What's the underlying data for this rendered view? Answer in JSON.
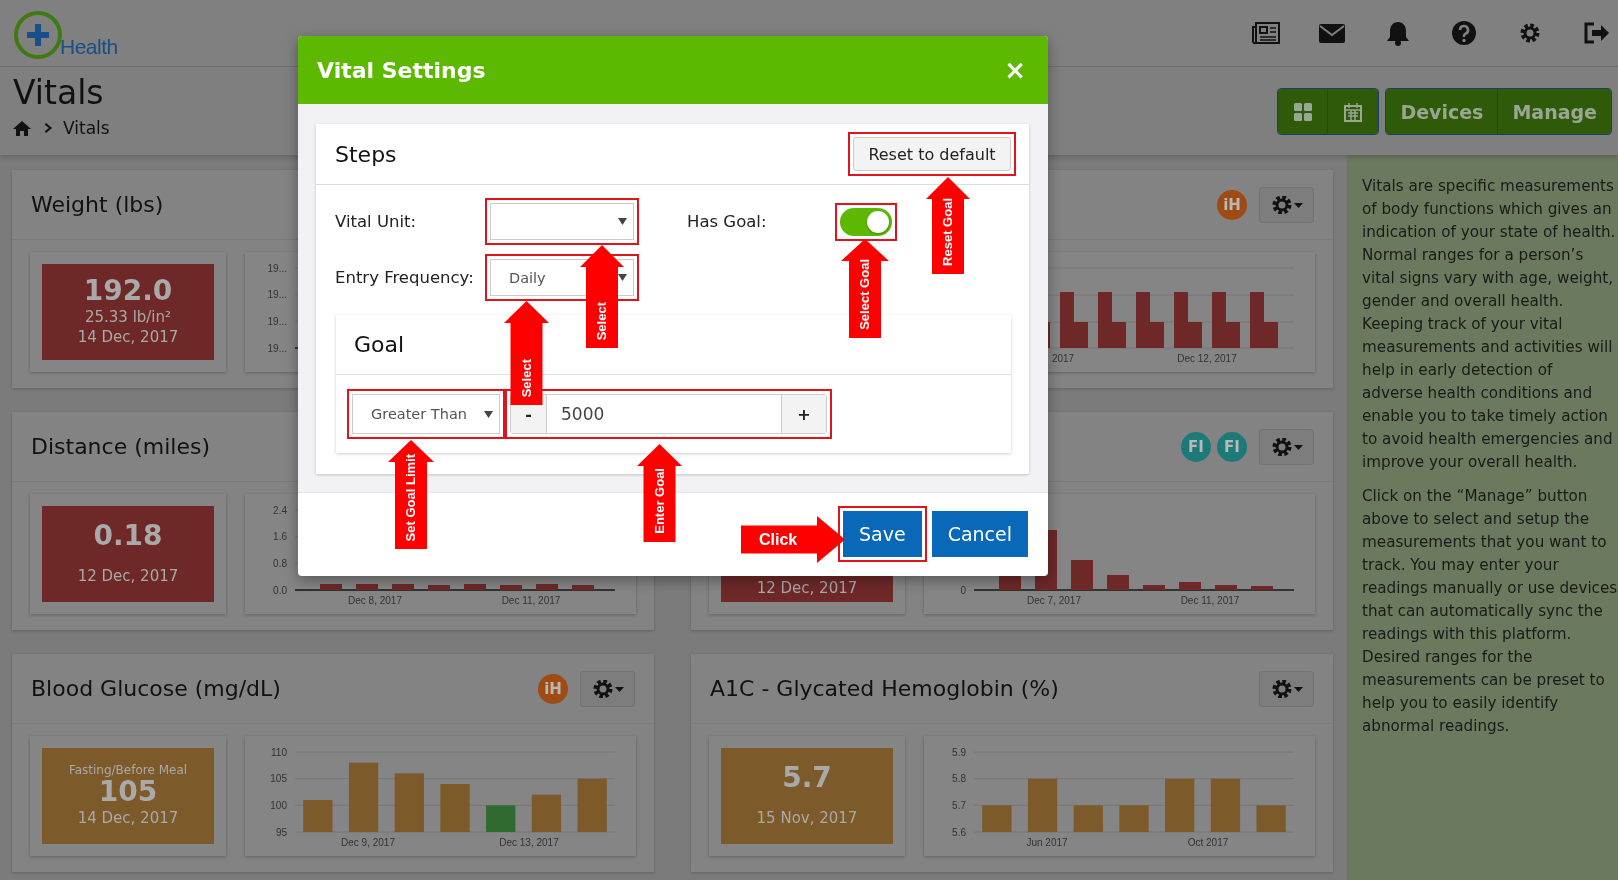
{
  "header": {
    "logo_text": "Health"
  },
  "page": {
    "title": "Vitals",
    "breadcrumb": [
      "Vitals"
    ],
    "actions": [
      "Devices",
      "Manage"
    ]
  },
  "cards": [
    {
      "title": "Weight (lbs)",
      "tile": {
        "color": "#6e2828",
        "value": "192.0",
        "subvalue": "25.33 lb/in²",
        "date": "14 Dec, 2017"
      },
      "chart": {
        "y_labels": [
          "19...",
          "19...",
          "19...",
          "19..."
        ]
      }
    },
    {
      "badges": [
        {
          "label": "iH",
          "color": "#a04a14"
        }
      ],
      "chart": {
        "x_labels": [
          "2017",
          "Dec 12, 2017"
        ]
      }
    },
    {
      "title": "Distance (miles)",
      "tile": {
        "color": "#6e2828",
        "value": "0.18",
        "date": "12 Dec, 2017"
      },
      "chart": {
        "y_labels": [
          "2.4",
          "1.6",
          "0.8",
          "0.0"
        ],
        "x_labels": [
          "Dec 8, 2017",
          "Dec 11, 2017"
        ]
      }
    },
    {
      "badges": [
        {
          "label": "FI",
          "color": "#1e7a78"
        },
        {
          "label": "FI",
          "color": "#1e7a78"
        }
      ],
      "tile": {
        "color": "#6e2828",
        "date": "12 Dec, 2017"
      },
      "chart": {
        "y_labels": [
          "0"
        ],
        "x_labels": [
          "Dec 7, 2017",
          "Dec 11, 2017"
        ]
      }
    },
    {
      "title": "Blood Glucose (mg/dL)",
      "badges": [
        {
          "label": "iH",
          "color": "#a04a14"
        }
      ],
      "tile": {
        "color": "#7c5a2a",
        "caption": "Fasting/Before Meal",
        "value": "105",
        "date": "14 Dec, 2017"
      },
      "x_labels": [
        "Dec 9, 2017",
        "Dec 13, 2017"
      ],
      "chart_data": {
        "type": "bar",
        "ylim": [
          95,
          110
        ],
        "yticks": [
          95,
          100,
          105,
          110
        ],
        "series": [
          {
            "color": "#7c5a2a",
            "values": [
              101,
              108,
              106,
              104,
              null,
              102,
              105
            ]
          },
          {
            "color": "#2f6b30",
            "values": [
              null,
              null,
              null,
              null,
              100,
              null,
              null
            ]
          }
        ]
      }
    },
    {
      "title": "A1C - Glycated Hemoglobin (%)",
      "tile": {
        "color": "#7c5a2a",
        "value": "5.7",
        "date": "15 Nov, 2017"
      },
      "x_labels": [
        "Jun 2017",
        "Oct 2017"
      ],
      "chart_data": {
        "type": "bar",
        "ylim": [
          5.6,
          5.9
        ],
        "yticks": [
          5.6,
          5.7,
          5.8,
          5.9
        ],
        "series": [
          {
            "color": "#7c5a2a",
            "values": [
              5.7,
              5.8,
              5.7,
              5.7,
              5.8,
              5.8,
              5.7
            ]
          }
        ]
      }
    }
  ],
  "sidebar": {
    "paragraphs": [
      "Vitals are specific measurements of body functions which gives an indication of your state of health. Normal ranges for a person’s vital signs vary with age, weight, gender and overall health. Keeping track of your vital measurements and activities will help in early detection of adverse health conditions and enable you to take timely action to avoid health emergencies and improve your overall health.",
      "Click on the “Manage” button above to select and setup the measurements that you want to track. You may enter your readings manually or use devices that can automatically sync the readings with this platform. Desired ranges for the measurements can be preset to help you to easily identify abnormal readings."
    ]
  },
  "modal": {
    "title": "Vital Settings",
    "close": "×",
    "panel": {
      "title": "Steps",
      "reset_button": {
        "label": "Reset to default",
        "highlighted": true
      },
      "vital_unit": {
        "label": "Vital Unit:",
        "highlighted": true
      },
      "entry_frequency": {
        "label": "Entry Frequency:",
        "value": "Daily",
        "highlighted": true
      },
      "has_goal": {
        "label": "Has Goal:",
        "on": true,
        "highlighted": true
      },
      "goal": {
        "title": "Goal",
        "limit": {
          "value": "Greater Than",
          "highlighted": true
        },
        "amount": {
          "minus": "-",
          "value": "5000",
          "plus": "+",
          "highlighted": true
        }
      }
    },
    "buttons": [
      {
        "kind": "primary",
        "label": "Save",
        "highlighted": true
      },
      {
        "kind": "primary",
        "label": "Cancel"
      }
    ]
  },
  "annotations": [
    {
      "kind": "arrow-up",
      "label": "Reset Goal"
    },
    {
      "kind": "arrow-up",
      "label": "Select Goal"
    },
    {
      "kind": "arrow-up",
      "label": "Select"
    },
    {
      "kind": "arrow-up",
      "label": "Select"
    },
    {
      "kind": "arrow-up",
      "label": "Set Goal Limit"
    },
    {
      "kind": "arrow-up",
      "label": "Enter Goal"
    },
    {
      "kind": "arrow-right",
      "label": "Click"
    }
  ]
}
